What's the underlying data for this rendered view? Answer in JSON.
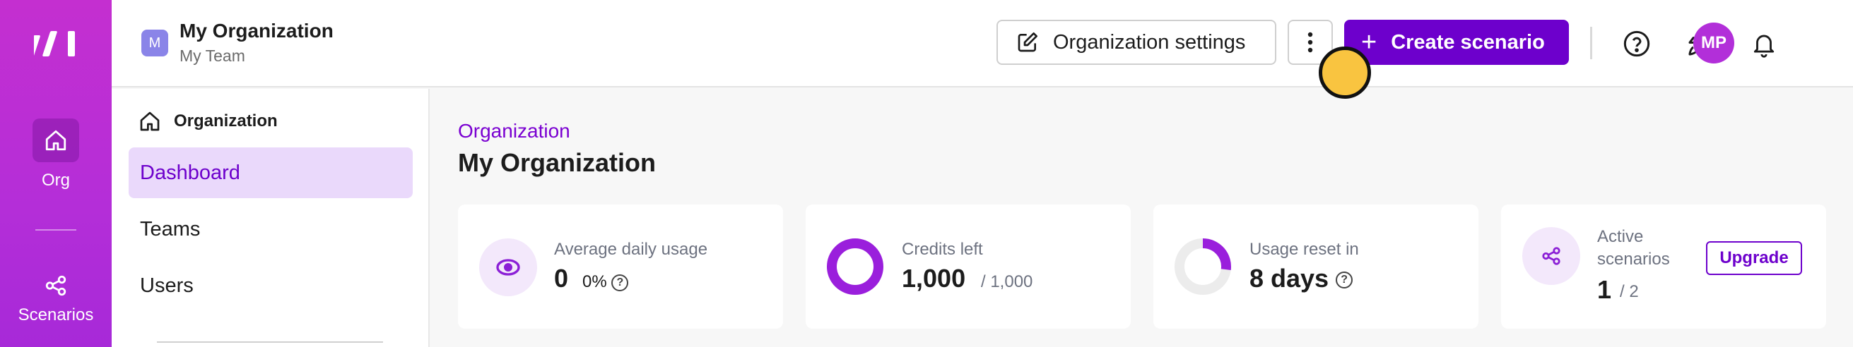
{
  "rail": {
    "items": [
      {
        "label": "Org",
        "icon": "home-icon"
      },
      {
        "label": "Scenarios",
        "icon": "share-nodes-icon"
      }
    ]
  },
  "header": {
    "org_initial": "M",
    "org_name": "My Organization",
    "team_name": "My Team",
    "settings_label": "Organization settings",
    "create_label": "Create scenario",
    "user_initials": "MP"
  },
  "subnav": {
    "heading": "Organization",
    "items": [
      {
        "label": "Dashboard",
        "active": true
      },
      {
        "label": "Teams",
        "active": false
      },
      {
        "label": "Users",
        "active": false
      }
    ]
  },
  "main": {
    "breadcrumb": "Organization",
    "title": "My Organization",
    "cards": {
      "usage": {
        "label": "Average daily usage",
        "value": "0",
        "percent": "0%"
      },
      "credits": {
        "label": "Credits left",
        "value": "1,000",
        "total": "/ 1,000",
        "fraction_left": 1.0
      },
      "reset": {
        "label": "Usage reset in",
        "value": "8 days",
        "ring_fraction": 0.27
      },
      "scenarios": {
        "label_line1": "Active",
        "label_line2": "scenarios",
        "value": "1",
        "total": "/ 2",
        "button": "Upgrade"
      }
    }
  },
  "colors": {
    "rail": "#b42ed8",
    "accent": "#6d00cc",
    "active_bg": "#ead9fb",
    "cursor": "#f9c440"
  }
}
